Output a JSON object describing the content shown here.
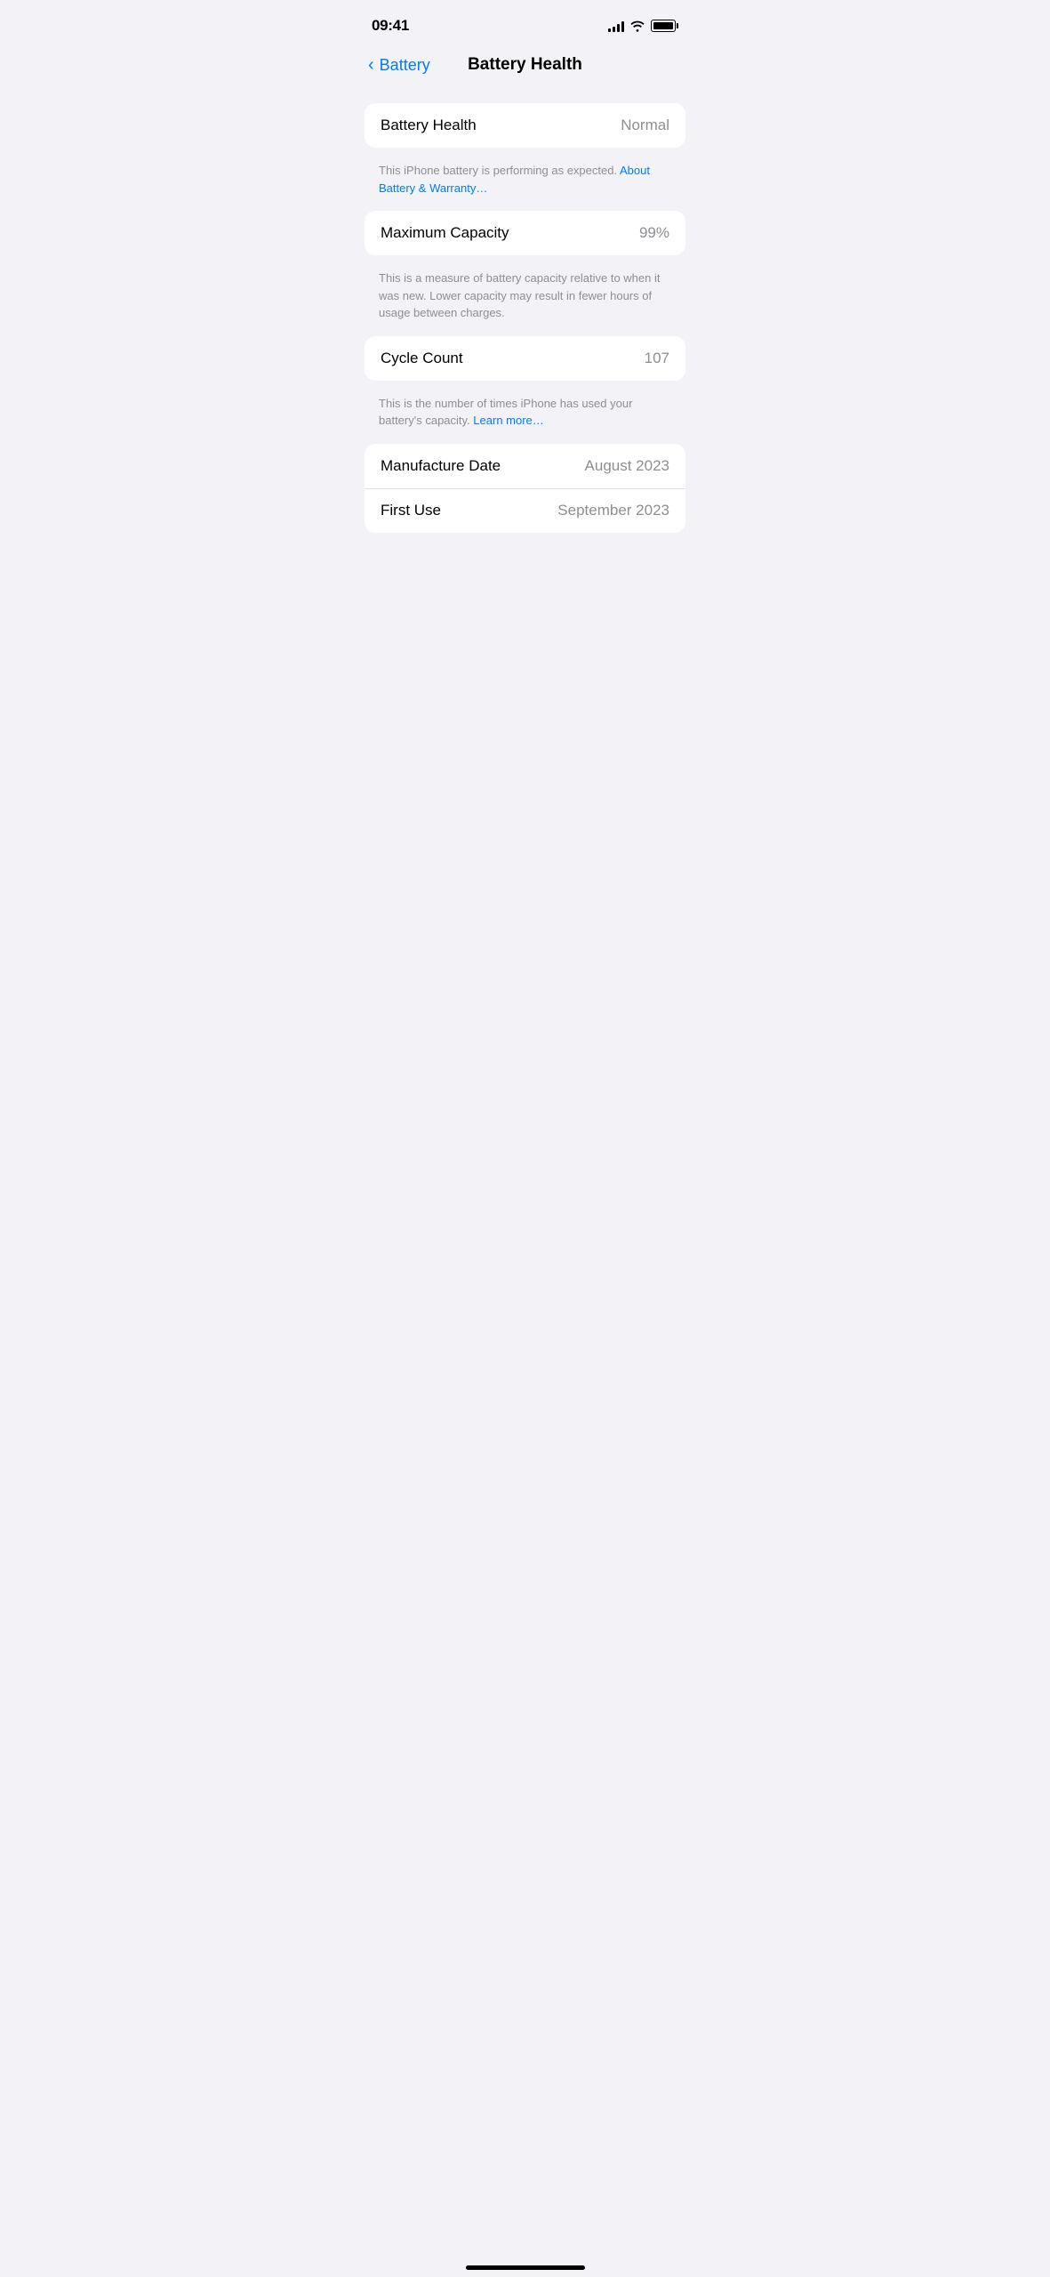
{
  "statusBar": {
    "time": "09:41",
    "signalBars": [
      4,
      6,
      9,
      12,
      14
    ],
    "batteryFull": true
  },
  "nav": {
    "backLabel": "Battery",
    "pageTitle": "Battery Health"
  },
  "sections": [
    {
      "id": "battery-health-section",
      "rows": [
        {
          "id": "battery-health-row",
          "label": "Battery Health",
          "value": "Normal"
        }
      ],
      "description": "This iPhone battery is performing as expected.",
      "linkText": "About Battery & Warranty…",
      "descriptionSuffix": ""
    },
    {
      "id": "maximum-capacity-section",
      "rows": [
        {
          "id": "maximum-capacity-row",
          "label": "Maximum Capacity",
          "value": "99%"
        }
      ],
      "description": "This is a measure of battery capacity relative to when it was new. Lower capacity may result in fewer hours of usage between charges.",
      "linkText": "",
      "descriptionSuffix": ""
    },
    {
      "id": "cycle-count-section",
      "rows": [
        {
          "id": "cycle-count-row",
          "label": "Cycle Count",
          "value": "107"
        }
      ],
      "description": "This is the number of times iPhone has used your battery's capacity.",
      "linkText": "Learn more…",
      "descriptionSuffix": ""
    },
    {
      "id": "dates-section",
      "rows": [
        {
          "id": "manufacture-date-row",
          "label": "Manufacture Date",
          "value": "August 2023"
        },
        {
          "id": "first-use-row",
          "label": "First Use",
          "value": "September 2023"
        }
      ],
      "description": "",
      "linkText": "",
      "descriptionSuffix": ""
    }
  ],
  "homeIndicator": true
}
